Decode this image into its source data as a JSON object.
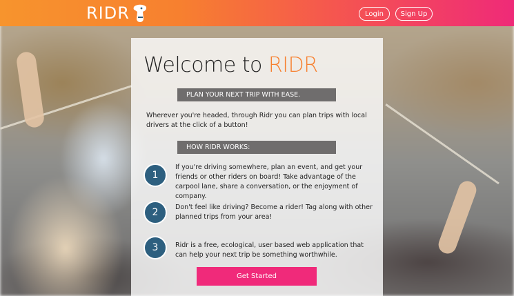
{
  "header": {
    "logo_text": "RIDR",
    "login_label": "Login",
    "signup_label": "Sign Up"
  },
  "hero": {
    "title_prefix": "Welcome to ",
    "title_brand": "RIDR"
  },
  "sections": {
    "plan_heading": "PLAN YOUR NEXT TRIP WITH EASE.",
    "intro_text": "Wherever you're headed, through Ridr you can plan trips with local drivers at the click of a button!",
    "how_heading": "HOW RIDR WORKS:"
  },
  "steps": [
    {
      "number": "1",
      "text": "If you're driving somewhere, plan an event, and get your friends or other riders on board! Take advantage of the carpool lane, share a conversation, or the enjoyment of company."
    },
    {
      "number": "2",
      "text": "Don't feel like driving? Become a rider! Tag along with other planned trips from your area!"
    },
    {
      "number": "3",
      "text": "Ridr is a free, ecological, user based web application that can help your next trip be something worthwhile."
    }
  ],
  "cta": {
    "label": "Get Started"
  },
  "colors": {
    "brand_orange": "#f7802f",
    "brand_pink": "#ef2a78",
    "step_circle": "#2d5f7f",
    "section_bar": "#6f6d6d"
  }
}
